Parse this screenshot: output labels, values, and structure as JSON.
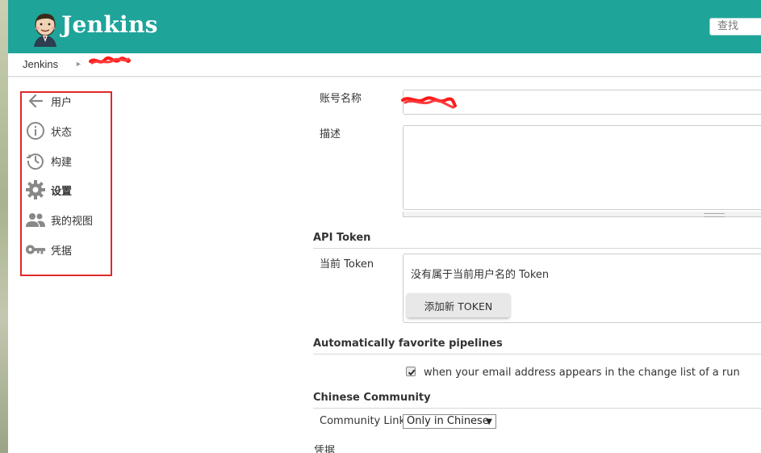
{
  "header": {
    "brand": "Jenkins",
    "search_placeholder": "查找",
    "background_color": "#1fa49a"
  },
  "breadcrumb": {
    "items": [
      "Jenkins"
    ],
    "separator_icon": "triangle-right-icon"
  },
  "sidebar": {
    "items": [
      {
        "label": "用户",
        "icon": "arrow-left-icon",
        "active": false
      },
      {
        "label": "状态",
        "icon": "info-circle-icon",
        "active": false
      },
      {
        "label": "构建",
        "icon": "history-clock-icon",
        "active": false
      },
      {
        "label": "设置",
        "icon": "gear-icon",
        "active": true
      },
      {
        "label": "我的视图",
        "icon": "people-icon",
        "active": false
      },
      {
        "label": "凭据",
        "icon": "key-icon",
        "active": false
      }
    ],
    "highlight_color": "#e0282a"
  },
  "form": {
    "account_name_label": "账号名称",
    "description_label": "描述",
    "api_token_section": "API Token",
    "current_token_label": "当前 Token",
    "no_token_text": "没有属于当前用户名的 Token",
    "add_token_button": "添加新 TOKEN",
    "auto_favorite_section": "Automatically favorite pipelines",
    "auto_favorite_checkbox_label": "when your email address appears in the change list of a run",
    "auto_favorite_checked": true,
    "chinese_community_section": "Chinese Community",
    "community_link_label": "Community Link",
    "community_link_value": "Only in Chinese",
    "truncated_label": "凭据"
  }
}
